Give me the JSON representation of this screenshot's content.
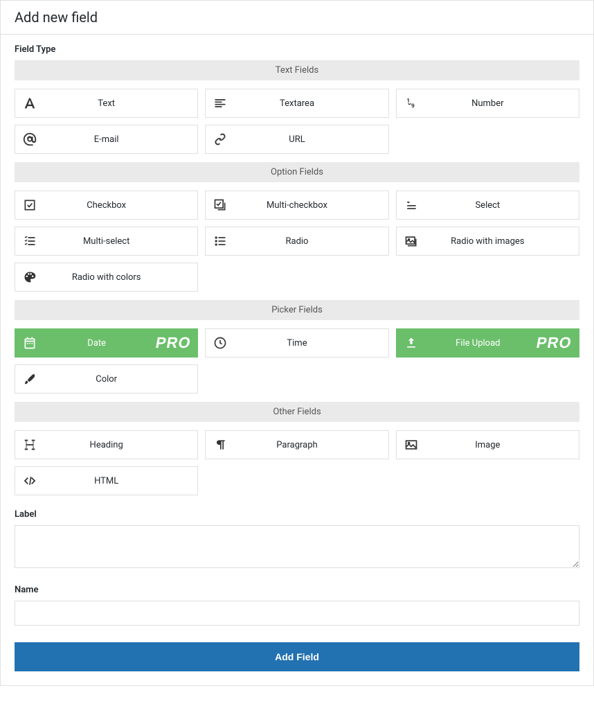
{
  "header": {
    "title": "Add new field"
  },
  "sections": {
    "field_type_label": "Field Type",
    "groups": {
      "text": {
        "header": "Text Fields",
        "items": [
          "Text",
          "Textarea",
          "Number",
          "E-mail",
          "URL"
        ]
      },
      "option": {
        "header": "Option Fields",
        "items": [
          "Checkbox",
          "Multi-checkbox",
          "Select",
          "Multi-select",
          "Radio",
          "Radio with images",
          "Radio with colors"
        ]
      },
      "picker": {
        "header": "Picker Fields",
        "items": [
          "Date",
          "Time",
          "File Upload",
          "Color"
        ],
        "pro_badge": "PRO"
      },
      "other": {
        "header": "Other Fields",
        "items": [
          "Heading",
          "Paragraph",
          "Image",
          "HTML"
        ]
      }
    }
  },
  "form": {
    "label_label": "Label",
    "label_value": "",
    "name_label": "Name",
    "name_value": ""
  },
  "submit": {
    "label": "Add Field"
  }
}
